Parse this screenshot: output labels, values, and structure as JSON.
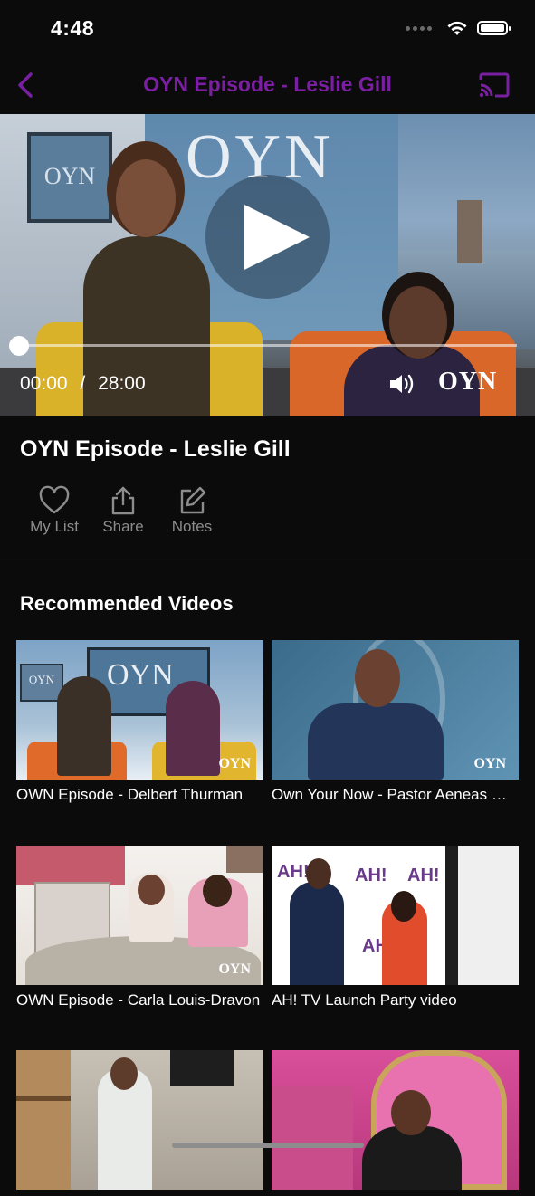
{
  "status_bar": {
    "time": "4:48"
  },
  "nav": {
    "title": "OYN Episode - Leslie Gill",
    "back_icon": "chevron-left-icon",
    "cast_icon": "cast-icon",
    "accent_color": "#7a1fa2"
  },
  "video": {
    "current_time": "00:00",
    "separator": "/",
    "duration": "28:00",
    "progress_fraction": 0.0,
    "brand_logo": "OYN",
    "backdrop_logo": "OYN",
    "side_screen_logo": "OYN",
    "play_icon": "play-icon",
    "volume_icon": "volume-icon"
  },
  "episode": {
    "title": "OYN Episode - Leslie Gill"
  },
  "actions": [
    {
      "label": "My List",
      "icon": "heart-icon"
    },
    {
      "label": "Share",
      "icon": "share-icon"
    },
    {
      "label": "Notes",
      "icon": "edit-icon"
    }
  ],
  "recommended": {
    "heading": "Recommended Videos",
    "items": [
      {
        "title": "OWN Episode - Delbert Thurman",
        "brand": "OYN",
        "screen_logo": "OYN",
        "side_logo": "OYN"
      },
      {
        "title": "Own Your Now - Pastor Aeneas Williams",
        "brand": "OYN"
      },
      {
        "title": "OWN Episode - Carla Louis-Dravon",
        "brand": "OYN"
      },
      {
        "title": "AH! TV Launch Party video",
        "logo": "AH!"
      },
      {
        "title": ""
      },
      {
        "title": ""
      }
    ]
  }
}
